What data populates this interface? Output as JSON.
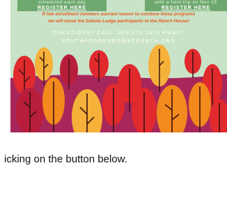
{
  "flyer": {
    "register_left": {
      "sub": "scheduled each day",
      "link": "REGISTER HERE"
    },
    "register_right": {
      "sub": "with a field trip on Nov 15",
      "link": "REGISTER HERE"
    },
    "notice_line1": "If low enrollment numbers warrant reason to combine these programs",
    "notice_line2": "we will move the Dakota Lodge participants to the Ranch House!",
    "contact_line1": "QUESTIONS? CALL: 303.979.1876 EMAIL:",
    "contact_line2": "YOUTHPROGRAMS@KCRANCH.ORG",
    "colors": {
      "background": "#c9e3c8",
      "ground": "#a8275a",
      "button": "#6ea86e",
      "notice": "#e55b1e",
      "leaf_red": "#e02a2e",
      "leaf_orange": "#f28a1e",
      "leaf_yellow": "#f6b13a",
      "leaf_crimson": "#b81e3a"
    },
    "illustration": "autumn-leaves"
  },
  "caption": "icking on the button below."
}
